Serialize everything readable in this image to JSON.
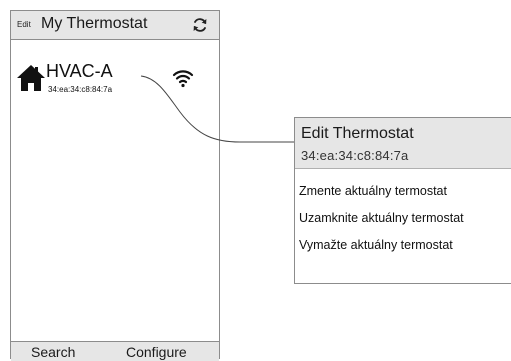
{
  "app": {
    "edit_label": "Edit",
    "title": "My Thermostat",
    "refresh_icon": "refresh-icon"
  },
  "device": {
    "name": "HVAC-A",
    "mac": "34:ea:34:c8:84:7a",
    "icon": "home-icon",
    "signal_icon": "wifi-icon"
  },
  "tabs": {
    "search": "Search",
    "configure": "Configure"
  },
  "popup": {
    "title": "Edit Thermostat",
    "subtitle": "34:ea:34:c8:84:7a",
    "items": [
      "Zmente aktuálny termostat",
      "Uzamknite aktuálny termostat",
      "Vymažte aktuálny termostat"
    ]
  },
  "colors": {
    "bar_background": "#e6e6e6",
    "border": "#8c8c8c",
    "text": "#111111"
  }
}
